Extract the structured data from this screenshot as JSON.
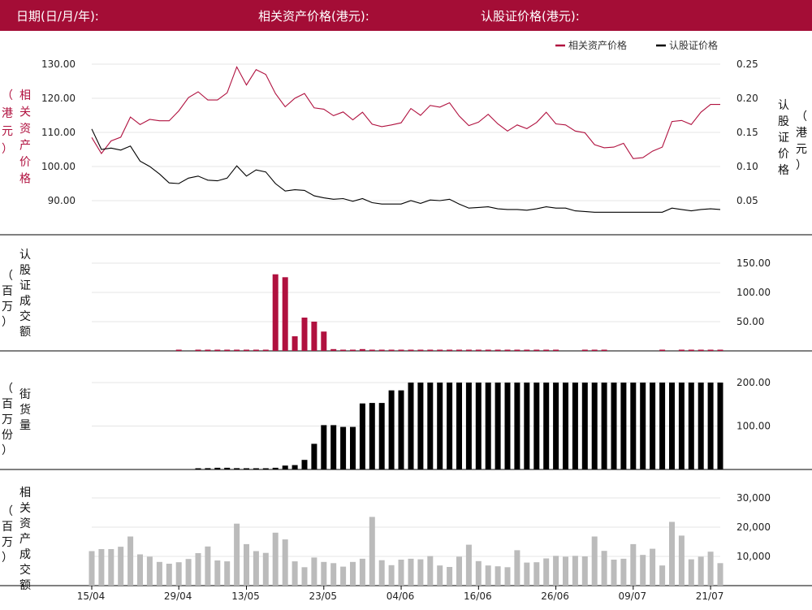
{
  "header": {
    "date_label": "日期(日/月/年):",
    "asset_price_label": "相关资产价格(港元):",
    "warrant_price_label": "认股证价格(港元):"
  },
  "colors": {
    "header_bg": "#a40d36",
    "asset": "#b0113f",
    "warrant": "#000000",
    "outstanding": "#000000",
    "underlying_turnover": "#bbbbbb",
    "grid": "#e4e4e4"
  },
  "chart_data": [
    {
      "id": "price",
      "type": "line",
      "legend": [
        "相关资产价格",
        "认股证价格"
      ],
      "legend_position": "top-right",
      "y_left_label": [
        "相",
        "关",
        "资",
        "产",
        "价",
        "格"
      ],
      "y_left_unit": [
        "（",
        "港",
        "元",
        "）"
      ],
      "y_right_label": [
        "认",
        "股",
        "证",
        "价",
        "格"
      ],
      "y_right_unit": [
        "（",
        "港",
        "元",
        "）"
      ],
      "y_left_ticks": [
        "130.00",
        "120.00",
        "110.00",
        "100.00",
        "90.00"
      ],
      "y_left_range": [
        81,
        131
      ],
      "y_right_ticks": [
        "0.25",
        "0.20",
        "0.15",
        "0.10",
        "0.05"
      ],
      "y_right_range": [
        0,
        0.25
      ],
      "series": [
        {
          "name": "相关资产价格",
          "axis": "left",
          "values": [
            108.5,
            103.8,
            107.5,
            108.6,
            114.5,
            112.3,
            113.8,
            113.4,
            113.4,
            116.3,
            120.2,
            121.9,
            119.5,
            119.5,
            121.6,
            129.2,
            123.9,
            128.4,
            127.0,
            121.4,
            117.5,
            120.0,
            121.4,
            117.2,
            116.8,
            114.9,
            116.0,
            113.7,
            115.9,
            112.4,
            111.7,
            112.2,
            112.8,
            117.0,
            115.0,
            117.9,
            117.4,
            118.7,
            114.8,
            112.0,
            113.0,
            115.3,
            112.5,
            110.4,
            112.2,
            111.1,
            112.9,
            115.9,
            112.5,
            112.2,
            110.4,
            109.9,
            106.4,
            105.5,
            105.7,
            106.8,
            102.3,
            102.6,
            104.5,
            105.7,
            113.2,
            113.5,
            112.3,
            115.9,
            118.2,
            118.2
          ]
        },
        {
          "name": "认股证价格",
          "axis": "right",
          "values": [
            0.155,
            0.125,
            0.127,
            0.124,
            0.13,
            0.108,
            0.1,
            0.089,
            0.076,
            0.075,
            0.083,
            0.086,
            0.08,
            0.079,
            0.083,
            0.101,
            0.086,
            0.095,
            0.092,
            0.075,
            0.064,
            0.066,
            0.065,
            0.057,
            0.054,
            0.052,
            0.053,
            0.049,
            0.053,
            0.047,
            0.045,
            0.045,
            0.045,
            0.05,
            0.046,
            0.051,
            0.05,
            0.052,
            0.045,
            0.039,
            0.04,
            0.041,
            0.038,
            0.037,
            0.037,
            0.036,
            0.038,
            0.041,
            0.039,
            0.039,
            0.035,
            0.034,
            0.033,
            0.033,
            0.033,
            0.033,
            0.033,
            0.033,
            0.033,
            0.033,
            0.039,
            0.037,
            0.035,
            0.037,
            0.038,
            0.037
          ]
        }
      ]
    },
    {
      "id": "warrant_turnover",
      "type": "bar",
      "y_label": [
        "认",
        "股",
        "证",
        "成",
        "交",
        "额"
      ],
      "y_unit": [
        "（",
        "百",
        "万",
        "）"
      ],
      "y_ticks": [
        "150.00",
        "100.00",
        "50.00"
      ],
      "y_range": [
        0,
        165
      ],
      "series": [
        {
          "name": "认股证成交额",
          "values": [
            0,
            0,
            0,
            0,
            0,
            0,
            0,
            0,
            0,
            0.8,
            0,
            0.5,
            0.5,
            0.5,
            0.5,
            0.5,
            0.5,
            0.5,
            0.5,
            131,
            126,
            25,
            57,
            50,
            33,
            3,
            2,
            1,
            3,
            1,
            1,
            1,
            1,
            1,
            1,
            1,
            1,
            1,
            1,
            1,
            1,
            1,
            1,
            1,
            1,
            1,
            1,
            1,
            1,
            0,
            0,
            1,
            1,
            1,
            0,
            0,
            0,
            0,
            0,
            1,
            0,
            1,
            1,
            1,
            1,
            1
          ]
        }
      ]
    },
    {
      "id": "outstanding",
      "type": "bar",
      "y_label": [
        "街",
        "货",
        "量"
      ],
      "y_unit": [
        "（",
        "百",
        "万",
        "份",
        "）"
      ],
      "y_ticks": [
        "200.00",
        "100.00"
      ],
      "y_range": [
        0,
        215
      ],
      "series": [
        {
          "name": "街货量",
          "values": [
            0,
            0,
            0,
            0,
            0,
            0,
            0,
            0,
            0,
            0,
            0,
            2,
            3,
            4,
            4,
            3,
            2,
            2,
            2,
            4,
            9,
            10,
            22,
            59,
            102,
            102,
            98,
            98,
            152,
            153,
            153,
            182,
            182,
            200,
            200,
            200,
            200,
            200,
            200,
            200,
            200,
            200,
            200,
            200,
            200,
            200,
            200,
            200,
            200,
            200,
            200,
            200,
            200,
            200,
            200,
            200,
            200,
            200,
            200,
            200,
            200,
            200,
            200,
            200,
            200,
            200
          ]
        }
      ]
    },
    {
      "id": "underlying_turnover",
      "type": "bar",
      "y_label": [
        "相",
        "关",
        "资",
        "产",
        "成",
        "交",
        "额"
      ],
      "y_unit": [
        "（",
        "百",
        "万",
        "）"
      ],
      "y_ticks": [
        "30,000",
        "20,000",
        "10,000"
      ],
      "y_range": [
        0,
        33000
      ],
      "x_labels": [
        "15/04",
        "29/04",
        "13/05",
        "23/05",
        "04/06",
        "16/06",
        "26/06",
        "09/07",
        "21/07"
      ],
      "series": [
        {
          "name": "相关资产成交额",
          "values": [
            11800,
            12500,
            12500,
            13300,
            16800,
            10700,
            9900,
            8100,
            7500,
            8000,
            9100,
            11100,
            13400,
            8600,
            8300,
            21200,
            14200,
            11800,
            11200,
            18100,
            15800,
            8300,
            6300,
            9600,
            8100,
            7700,
            6500,
            8100,
            9200,
            23500,
            8700,
            7000,
            8900,
            9200,
            9000,
            10100,
            6900,
            6400,
            9900,
            14000,
            8400,
            6900,
            6600,
            6300,
            12100,
            7900,
            8000,
            9300,
            10200,
            9900,
            10200,
            10000,
            16800,
            11900,
            8900,
            9200,
            14200,
            10500,
            12600,
            6900,
            21800,
            17100,
            9000,
            9900,
            11600,
            7700
          ]
        }
      ]
    }
  ]
}
